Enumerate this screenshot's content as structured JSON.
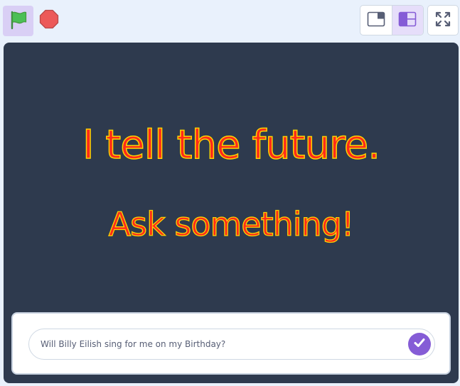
{
  "toolbar": {
    "green_flag": {
      "icon": "green-flag-icon",
      "color": "#4cbf56",
      "active_bg": "#d9cff5"
    },
    "stop": {
      "icon": "stop-icon",
      "color": "#ec5959"
    },
    "layout_small_stage": {
      "icon": "small-stage-layout-icon"
    },
    "layout_large_stage": {
      "icon": "large-stage-layout-icon",
      "active": true
    },
    "fullscreen": {
      "icon": "fullscreen-icon"
    }
  },
  "stage": {
    "background": "#2e3a4e",
    "text_color": "#ff2a1a",
    "text_outline": "#ffd400",
    "line1": "I tell the future.",
    "line2": "Ask something!"
  },
  "ask_prompt": {
    "input_value": "Will Billy Eilish sing for me on my Birthday?",
    "submit_icon": "check-icon",
    "accent": "#855cd6"
  }
}
